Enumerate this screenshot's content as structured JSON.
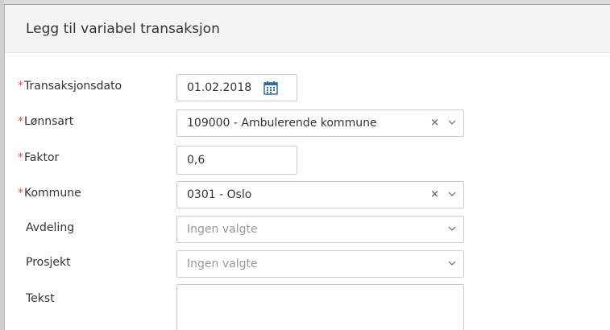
{
  "dialog": {
    "title": "Legg til variabel transaksjon"
  },
  "fields": {
    "transaksjonsdato": {
      "label": "Transaksjonsdato",
      "value": "01.02.2018",
      "required": true
    },
    "lonnsart": {
      "label": "Lønnsart",
      "value": "109000 - Ambulerende kommune",
      "required": true
    },
    "faktor": {
      "label": "Faktor",
      "value": "0,6",
      "required": true
    },
    "kommune": {
      "label": "Kommune",
      "value": "0301 - Oslo",
      "required": true
    },
    "avdeling": {
      "label": "Avdeling",
      "placeholder": "Ingen valgte",
      "required": false
    },
    "prosjekt": {
      "label": "Prosjekt",
      "placeholder": "Ingen valgte",
      "required": false
    },
    "tekst": {
      "label": "Tekst",
      "value": "",
      "required": false
    }
  },
  "required_marker": "*",
  "clear_glyph": "×",
  "colors": {
    "required": "#d9534f",
    "calendar": "#2e6da4",
    "header_bg": "#f4f4f4"
  }
}
